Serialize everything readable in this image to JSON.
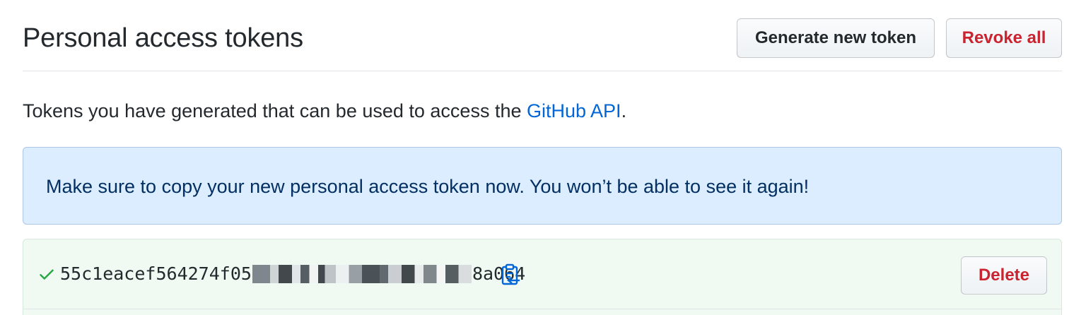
{
  "header": {
    "title": "Personal access tokens",
    "generate_label": "Generate new token",
    "revoke_label": "Revoke all"
  },
  "description": {
    "text_before": "Tokens you have generated that can be used to access the ",
    "link_text": "GitHub API",
    "text_after": "."
  },
  "flash": {
    "message": "Make sure to copy your new personal access token now. You won’t be able to see it again!"
  },
  "token": {
    "prefix": "55c1eacef564274f05",
    "suffix": "8a064",
    "delete_label": "Delete",
    "icons": {
      "status": "check-icon",
      "copy": "clipboard-icon"
    }
  },
  "colors": {
    "link": "#0366d6",
    "danger": "#cb2431",
    "success": "#28a745",
    "flash_bg": "#dbedff",
    "token_bg": "#f0f9f2"
  }
}
